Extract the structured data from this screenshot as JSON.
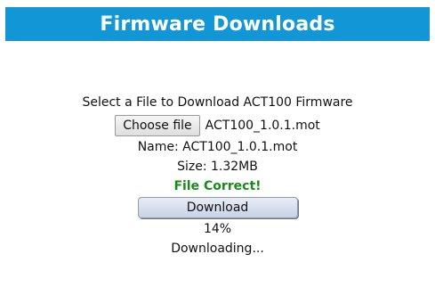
{
  "header": {
    "title": "Firmware Downloads"
  },
  "form": {
    "prompt": "Select a File to Download ACT100 Firmware",
    "choose_file_label": "Choose file",
    "selected_file": "ACT100_1.0.1.mot",
    "name_label": "Name: ACT100_1.0.1.mot",
    "size_label": "Size:  1.32MB",
    "status": "File Correct!",
    "download_label": "Download",
    "progress_text": "14%",
    "state_text": "Downloading..."
  },
  "colors": {
    "header_bg": "#1296d6",
    "success": "#1a8a1a"
  }
}
